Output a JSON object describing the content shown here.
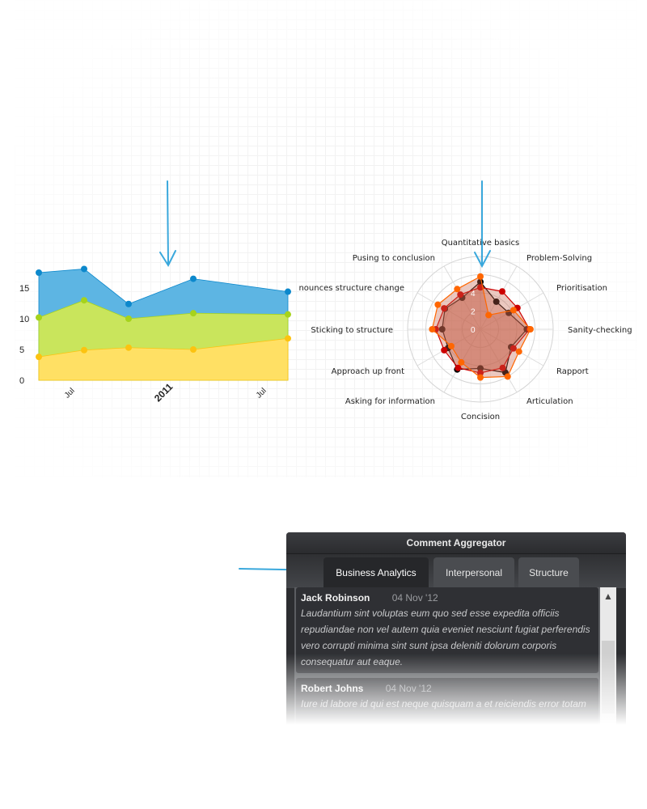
{
  "colors": {
    "blue": "#5db5e3",
    "blue_dot": "#0c88cc",
    "green": "#c9e55c",
    "green_dot": "#a6d31b",
    "yellow": "#ffe064",
    "yellow_dot": "#fcc310",
    "arrow": "#3aa8dc",
    "radar_fill": "#c6614a"
  },
  "chart_data": [
    {
      "type": "area",
      "stacked": true,
      "x_tick_labels": [
        "Jul",
        "2011",
        "Jul"
      ],
      "y_ticks": [
        0,
        5,
        10,
        15
      ],
      "ylim": [
        0,
        18
      ],
      "grid": false,
      "series": [
        {
          "color": "yellow",
          "values": [
            3.8,
            4.9,
            5.3,
            5.0,
            6.8
          ]
        },
        {
          "color": "green",
          "values": [
            6.4,
            8.1,
            4.7,
            5.9,
            3.9
          ]
        },
        {
          "color": "blue",
          "values": [
            7.3,
            5.1,
            2.4,
            5.6,
            3.7
          ]
        }
      ]
    },
    {
      "type": "radar",
      "categories": [
        "Quantitative basics",
        "Problem-Solving",
        "Prioritisation",
        "Sanity-checking",
        "Rapport",
        "Articulation",
        "Concision",
        "Asking for information",
        "Approach up front",
        "Sticking to structure",
        "nounces structure change",
        "Pusing to conclusion"
      ],
      "radial_ticks": [
        "0",
        "2",
        "4"
      ],
      "rmax": 8,
      "series": [
        {
          "color": "#000000",
          "values": [
            5.2,
            3.5,
            3.6,
            5.1,
            3.9,
            5.5,
            4.3,
            5.1,
            4.1,
            4.2,
            4.5,
            4.0
          ]
        },
        {
          "color": "#cc0000",
          "values": [
            4.6,
            4.8,
            4.7,
            5.4,
            4.2,
            4.9,
            4.8,
            4.9,
            4.6,
            4.9,
            4.6,
            4.4
          ]
        },
        {
          "color": "#ff6600",
          "values": [
            5.8,
            1.8,
            4.2,
            5.5,
            4.9,
            6.0,
            5.3,
            4.2,
            3.7,
            5.3,
            5.4,
            5.1
          ]
        }
      ]
    }
  ],
  "widget": {
    "title": "Comment Aggregator",
    "tabs": [
      "Business Analytics",
      "Interpersonal",
      "Structure"
    ],
    "scroll_up_icon": "▲",
    "comments": [
      {
        "author": "Jack Robinson",
        "date": "04 Nov '12",
        "text": "Laudantium sint voluptas eum quo sed esse expedita officiis repudiandae non vel autem quia eveniet nesciunt fugiat perferendis vero corrupti minima sint sunt ipsa deleniti dolorum corporis consequatur aut eaque."
      },
      {
        "author": "Robert Johns",
        "date": "04 Nov '12",
        "text": "Iure id labore id qui est neque quisquam a et reiciendis error totam"
      }
    ]
  }
}
